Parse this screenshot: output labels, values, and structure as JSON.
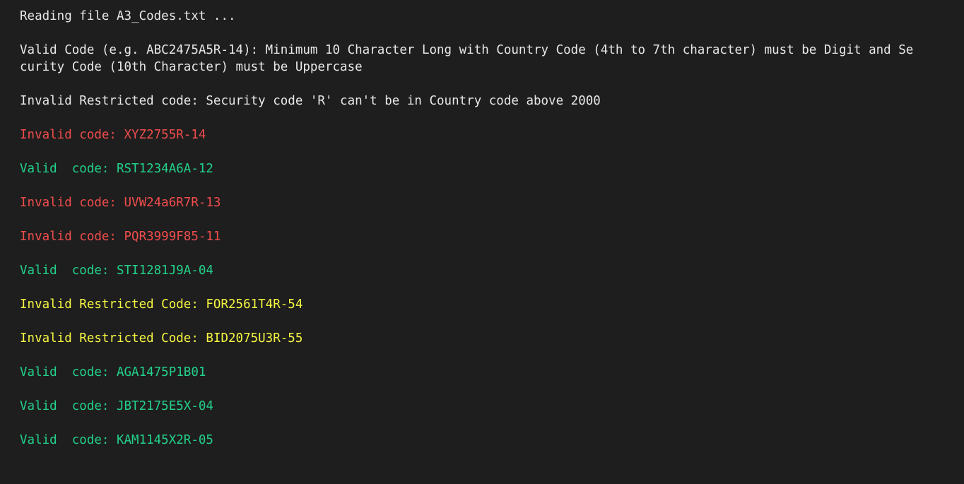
{
  "lines": [
    {
      "text": "Reading file A3_Codes.txt ...",
      "color": "#e8e8e8"
    },
    {
      "text": "Valid Code (e.g. ABC2475A5R-14): Minimum 10 Character Long with Country Code (4th to 7th character) must be Digit and Se",
      "color": "#e8e8e8"
    },
    {
      "text": "curity Code (10th Character) must be Uppercase",
      "color": "#e8e8e8"
    },
    {
      "text": "Invalid Restricted code: Security code 'R' can't be in Country code above 2000",
      "color": "#e8e8e8"
    },
    {
      "text": "Invalid code: XYZ2755R-14",
      "color": "#f14c4c"
    },
    {
      "text": "Valid  code: RST1234A6A-12",
      "color": "#23d18b"
    },
    {
      "text": "Invalid code: UVW24a6R7R-13",
      "color": "#f14c4c"
    },
    {
      "text": "Invalid code: PQR3999F85-11",
      "color": "#f14c4c"
    },
    {
      "text": "Valid  code: STI1281J9A-04",
      "color": "#23d18b"
    },
    {
      "text": "Invalid Restricted Code: FOR2561T4R-54",
      "color": "#f5f543"
    },
    {
      "text": "Invalid Restricted Code: BID2075U3R-55",
      "color": "#f5f543"
    },
    {
      "text": "Valid  code: AGA1475P1B01",
      "color": "#23d18b"
    },
    {
      "text": "Valid  code: JBT2175E5X-04",
      "color": "#23d18b"
    },
    {
      "text": "Valid  code: KAM1145X2R-05",
      "color": "#23d18b"
    }
  ]
}
